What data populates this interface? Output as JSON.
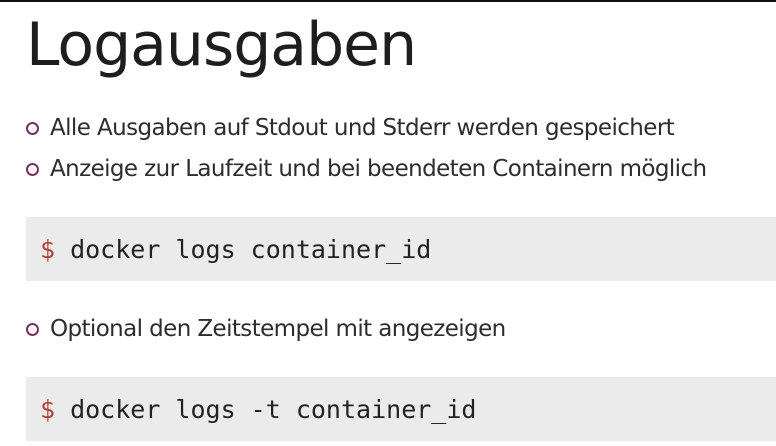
{
  "slide": {
    "title": "Logausgaben",
    "bullets": [
      "Alle Ausgaben auf Stdout und Stderr werden gespeichert",
      "Anzeige zur Laufzeit und bei beendeten Containern möglich",
      "Optional den Zeitstempel mit angezeigen"
    ],
    "code_blocks": [
      {
        "prompt": "$",
        "command": "docker logs container_id"
      },
      {
        "prompt": "$",
        "command": "docker logs -t container_id"
      }
    ]
  },
  "colors": {
    "bullet_marker": "#7a2f63",
    "prompt": "#b5403a",
    "code_background": "#ebebeb"
  }
}
